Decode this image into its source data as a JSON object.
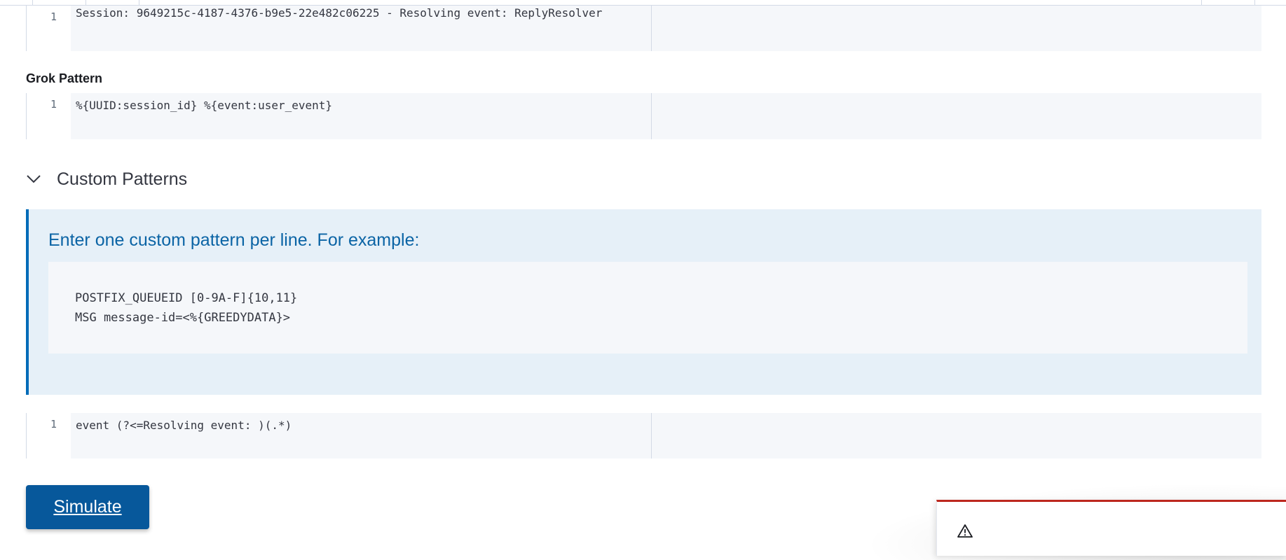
{
  "sample_data": {
    "line_number": "1",
    "code": "Session: 9649215c-4187-4376-b9e5-22e482c06225 - Resolving event: ReplyResolver"
  },
  "grok_pattern": {
    "label": "Grok Pattern",
    "line_number": "1",
    "code": "%{UUID:session_id} %{event:user_event}"
  },
  "custom_patterns": {
    "toggle_label": "Custom Patterns",
    "callout_title": "Enter one custom pattern per line. For example:",
    "example_lines": [
      "POSTFIX_QUEUEID [0-9A-F]{10,11}",
      "MSG message-id=<%{GREEDYDATA}>"
    ],
    "line_number": "1",
    "code": "event (?<=Resolving event: )(.*)"
  },
  "actions": {
    "simulate_label": "Simulate"
  },
  "toast": {
    "icon": "warning-icon",
    "accent_color": "#bd271e"
  },
  "colors": {
    "primary": "#07589b",
    "callout_bg": "#e6f0f8",
    "callout_accent": "#006bb8",
    "editor_bg": "#f5f7fa"
  }
}
